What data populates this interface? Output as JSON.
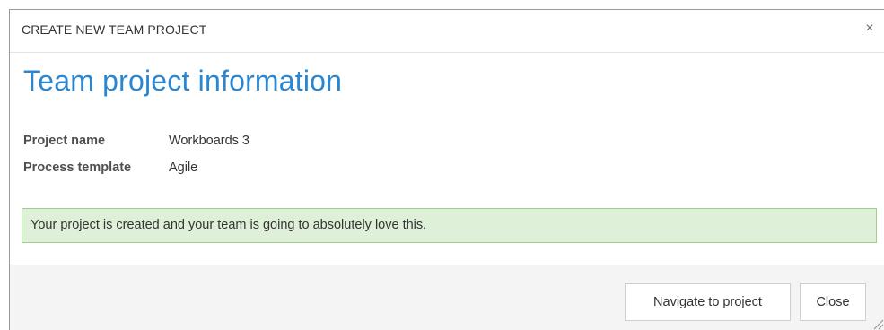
{
  "dialog": {
    "title": "CREATE NEW TEAM PROJECT",
    "close_glyph": "×",
    "heading": "Team project information",
    "fields": [
      {
        "label": "Project name",
        "value": "Workboards 3"
      },
      {
        "label": "Process template",
        "value": "Agile"
      }
    ],
    "success_message": "Your project is created and your team is going to absolutely love this.",
    "buttons": {
      "navigate_label": "Navigate to project",
      "close_label": "Close"
    },
    "icons": {
      "close": "close-icon",
      "resize": "resize-grip-icon"
    },
    "colors": {
      "heading": "#2a86d0",
      "success_bg": "#dff0d8",
      "success_border": "#9fcf8a",
      "footer_bg": "#f4f4f4"
    }
  }
}
